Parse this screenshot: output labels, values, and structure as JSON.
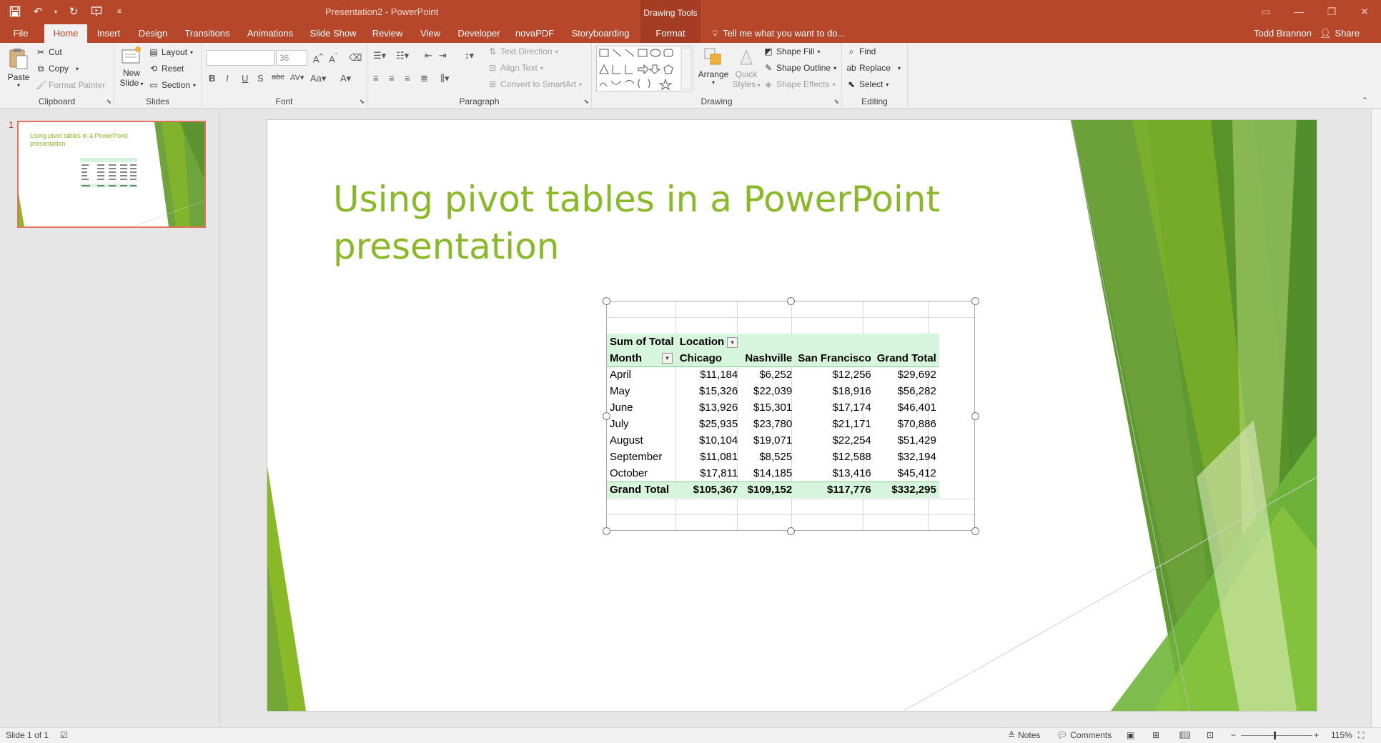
{
  "titlebar": {
    "doc_title": "Presentation2 - PowerPoint",
    "context_header": "Drawing Tools"
  },
  "tabs": [
    "File",
    "Home",
    "Insert",
    "Design",
    "Transitions",
    "Animations",
    "Slide Show",
    "Review",
    "View",
    "Developer",
    "novaPDF",
    "Storyboarding",
    "Format"
  ],
  "tellme": "Tell me what you want to do...",
  "user": {
    "name": "Todd Brannon",
    "share": "Share"
  },
  "ribbon": {
    "clipboard": {
      "label": "Clipboard",
      "paste": "Paste",
      "cut": "Cut",
      "copy": "Copy",
      "format_painter": "Format Painter"
    },
    "slides": {
      "label": "Slides",
      "new_slide_1": "New",
      "new_slide_2": "Slide",
      "layout": "Layout",
      "reset": "Reset",
      "section": "Section"
    },
    "font": {
      "label": "Font",
      "size": "36"
    },
    "paragraph": {
      "label": "Paragraph",
      "text_direction": "Text Direction",
      "align_text": "Align Text",
      "convert_smartart": "Convert to SmartArt"
    },
    "drawing": {
      "label": "Drawing",
      "arrange": "Arrange",
      "quick_styles_1": "Quick",
      "quick_styles_2": "Styles",
      "shape_fill": "Shape Fill",
      "shape_outline": "Shape Outline",
      "shape_effects": "Shape Effects"
    },
    "editing": {
      "label": "Editing",
      "find": "Find",
      "replace": "Replace",
      "select": "Select"
    }
  },
  "thumbnail": {
    "number": "1",
    "title": "Using pivot tables in a PowerPoint presentation"
  },
  "slide": {
    "title": "Using pivot tables in a PowerPoint presentation"
  },
  "pivot": {
    "corner": "Sum of Total",
    "col_field": "Location",
    "row_field": "Month",
    "columns": [
      "Chicago",
      "Nashville",
      "San Francisco",
      "Grand Total"
    ],
    "rows": [
      {
        "month": "April",
        "values": [
          "$11,184",
          "$6,252",
          "$12,256",
          "$29,692"
        ]
      },
      {
        "month": "May",
        "values": [
          "$15,326",
          "$22,039",
          "$18,916",
          "$56,282"
        ]
      },
      {
        "month": "June",
        "values": [
          "$13,926",
          "$15,301",
          "$17,174",
          "$46,401"
        ]
      },
      {
        "month": "July",
        "values": [
          "$25,935",
          "$23,780",
          "$21,171",
          "$70,886"
        ]
      },
      {
        "month": "August",
        "values": [
          "$10,104",
          "$19,071",
          "$22,254",
          "$51,429"
        ]
      },
      {
        "month": "September",
        "values": [
          "$11,081",
          "$8,525",
          "$12,588",
          "$32,194"
        ]
      },
      {
        "month": "October",
        "values": [
          "$17,811",
          "$14,185",
          "$13,416",
          "$45,412"
        ]
      }
    ],
    "total": {
      "label": "Grand Total",
      "values": [
        "$105,367",
        "$109,152",
        "$117,776",
        "$332,295"
      ]
    }
  },
  "statusbar": {
    "slide_info": "Slide 1 of 1",
    "notes": "Notes",
    "comments": "Comments",
    "zoom": "115%"
  },
  "colors": {
    "accent": "#b7472a",
    "title_green": "#8ab927",
    "pivot_header": "#d7f5dd"
  }
}
